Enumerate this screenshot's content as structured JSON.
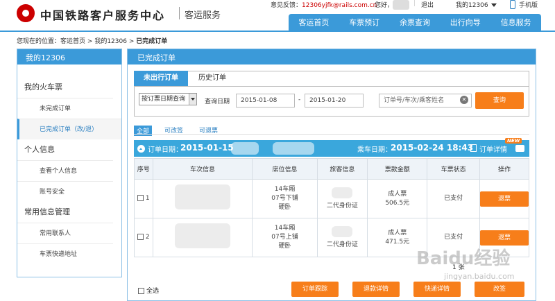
{
  "header": {
    "site_title": "中国铁路客户服务中心",
    "site_sub": "客运服务",
    "feedback_label": "意见反馈：",
    "feedback_email": "12306yjfk@rails.com.cn",
    "greeting": "您好，",
    "logout": "退出",
    "my12306": "我的12306",
    "mobile": "手机版"
  },
  "nav": [
    "客运首页",
    "车票预订",
    "余票查询",
    "出行向导",
    "信息服务"
  ],
  "breadcrumb": {
    "prefix": "您现在的位置：",
    "home": "客运首页",
    "sep": ">",
    "mine": "我的12306",
    "current": "已完成订单"
  },
  "sidebar": {
    "title": "我的12306",
    "sections": [
      {
        "title": "我的火车票",
        "items": [
          "未完成订单",
          "已完成订单（改/退）"
        ]
      },
      {
        "title": "个人信息",
        "items": [
          "查看个人信息",
          "账号安全"
        ]
      },
      {
        "title": "常用信息管理",
        "items": [
          "常用联系人",
          "车票快递地址"
        ]
      }
    ]
  },
  "main": {
    "title": "已完成订单",
    "tabs": [
      "未出行订单",
      "历史订单"
    ],
    "query_type": "按订票日期查询",
    "date_label": "查询日期",
    "date_from": "2015-01-08",
    "date_sep": "-",
    "date_to": "2015-01-20",
    "search_placeholder": "订单号/车次/乘客姓名",
    "search_button": "查询",
    "filters": [
      "全部",
      "可改签",
      "可退票"
    ]
  },
  "order": {
    "order_date_label": "订单日期：",
    "order_date": "2015-01-15",
    "ride_date_label": "乘车日期：",
    "ride_date": "2015-02-24 18:43",
    "detail_label": "订单详情",
    "new_badge": "NEW",
    "columns": [
      "序号",
      "车次信息",
      "席位信息",
      "旅客信息",
      "票款金额",
      "车票状态",
      "操作"
    ],
    "rows": [
      {
        "no": "1",
        "seat": [
          "14车厢",
          "07号下铺",
          "硬卧"
        ],
        "passenger": "二代身份证",
        "ticket_type": "成人票",
        "price": "506.5元",
        "status": "已支付",
        "action": "退票"
      },
      {
        "no": "2",
        "seat": [
          "14车厢",
          "07号上铺",
          "硬卧"
        ],
        "passenger": "二代身份证",
        "ticket_type": "成人票",
        "price": "471.5元",
        "status": "已支付",
        "action": "退票"
      }
    ],
    "page_note": "1 张"
  },
  "footer": {
    "select_all": "全选",
    "buttons": [
      "订单跟踪",
      "退款详情",
      "快递详情",
      "改签"
    ]
  },
  "watermark": {
    "main": "Baidu经验",
    "sub": "jingyan.baidu.com"
  },
  "colors": {
    "primary_blue": "#3b9ad9",
    "accent_orange": "#f77e1a"
  }
}
